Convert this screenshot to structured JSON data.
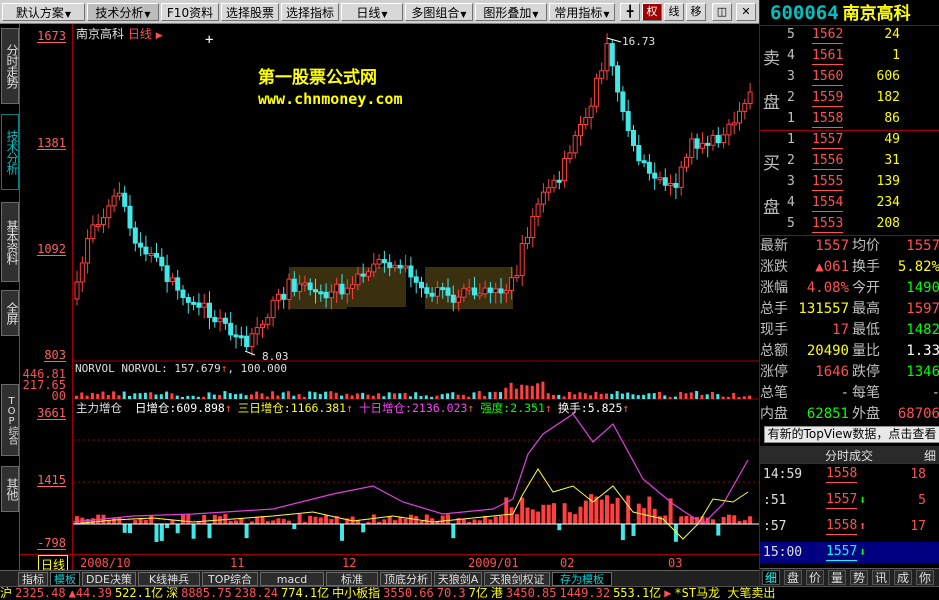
{
  "menubar": {
    "items": [
      {
        "label": "默认方案",
        "dd": true
      },
      {
        "label": "技术分析",
        "dd": true
      },
      {
        "label": "F10资料"
      },
      {
        "label": "选择股票"
      },
      {
        "label": "选择指标"
      },
      {
        "label": "日线",
        "dd": true
      },
      {
        "label": "多图组合",
        "dd": true
      },
      {
        "label": "图形叠加",
        "dd": true
      },
      {
        "label": "常用指标",
        "dd": true
      }
    ],
    "tools": [
      {
        "name": "crosshair-icon",
        "glyph": "╋"
      },
      {
        "name": "quan-button",
        "glyph": "权"
      },
      {
        "name": "line-button",
        "glyph": "线"
      },
      {
        "name": "move-button",
        "glyph": "移"
      },
      {
        "name": "toggle-panel-icon",
        "glyph": "◫"
      },
      {
        "name": "close-icon",
        "glyph": "✕"
      }
    ]
  },
  "left_tabs": [
    {
      "label": "分时走势",
      "active": false
    },
    {
      "label": "技术分析",
      "active": true
    },
    {
      "label": "基本资料",
      "active": false
    },
    {
      "label": "全屏",
      "active": false
    },
    {
      "label": "TOP综合",
      "active": false
    },
    {
      "label": "其他",
      "active": false
    }
  ],
  "y_axis": {
    "main": [
      "1673",
      "1381",
      "1092",
      "803"
    ],
    "vol": [
      "446.81",
      "217.65",
      "00"
    ],
    "ind": [
      "3661",
      "1415",
      "-798"
    ]
  },
  "x_axis": {
    "period": "日线",
    "labels": [
      "2008/10",
      "11",
      "12",
      "2009/01",
      "02",
      "03"
    ],
    "max_label": "16.73",
    "min_label": "8.03"
  },
  "chart_header": {
    "stock": "南京高科",
    "period": "日线",
    "indicator_mark": "▶"
  },
  "watermark": {
    "line1": "第一股票公式网",
    "line2": "www.chnmoney.com"
  },
  "vol_header": {
    "name": "NORVOL",
    "text": "NORVOL: 157.679",
    "arrow": "↑",
    "value2": ", 100.000"
  },
  "ind_header": {
    "title": "主力增仓",
    "items": [
      {
        "label": "日增仓:",
        "value": "609.898",
        "arrow": "↑",
        "color": "#ffffff"
      },
      {
        "label": "三日增仓:",
        "value": "1166.381",
        "arrow": "↑",
        "color": "#ffff00"
      },
      {
        "label": "十日增仓:",
        "value": "2136.023",
        "arrow": "↑",
        "color": "#ff40ff"
      },
      {
        "label": "强度:",
        "value": "2.351",
        "arrow": "↑",
        "color": "#00ff00"
      },
      {
        "label": "换手:",
        "value": "5.825",
        "arrow": "↑",
        "color": "#ffffff"
      }
    ]
  },
  "bottom_tabs": [
    {
      "label": "指标"
    },
    {
      "label": "模板",
      "active": true
    },
    {
      "label": "DDE决策"
    },
    {
      "label": "K线神兵"
    },
    {
      "label": "TOP综合"
    },
    {
      "label": "macd"
    },
    {
      "label": "标准"
    },
    {
      "label": "顶底分析"
    },
    {
      "label": "天狼剑A"
    },
    {
      "label": "天狼剑权证"
    },
    {
      "label": "存为模板",
      "active": true
    }
  ],
  "ticker": [
    {
      "t": "沪",
      "c": "#ffff00"
    },
    {
      "t": "2325.48",
      "c": "#ff5050"
    },
    {
      "t": "▲44.39",
      "c": "#ff5050"
    },
    {
      "t": "522.1亿",
      "c": "#ffff00"
    },
    {
      "t": "深",
      "c": "#ffff00"
    },
    {
      "t": "8885.75",
      "c": "#ff5050"
    },
    {
      "t": "238.24",
      "c": "#ff5050"
    },
    {
      "t": "774.1亿",
      "c": "#ffff00"
    },
    {
      "t": "中小板指",
      "c": "#ffff00"
    },
    {
      "t": "3550.66",
      "c": "#ff5050"
    },
    {
      "t": "70.3",
      "c": "#ff5050"
    },
    {
      "t": "7亿",
      "c": "#ffff00"
    },
    {
      "t": "港",
      "c": "#ffff00"
    },
    {
      "t": "3450.85",
      "c": "#ff5050"
    },
    {
      "t": "1449.32",
      "c": "#ff5050"
    },
    {
      "t": "553.1亿",
      "c": "#ffff00"
    },
    {
      "t": "▶",
      "c": "#ff5050"
    },
    {
      "t": "*ST马龙 大笔卖出",
      "c": "#ffff00"
    }
  ],
  "right": {
    "code": "600064",
    "name": "南京高科",
    "sell_label": [
      "卖",
      "盘"
    ],
    "buy_label": [
      "买",
      "盘"
    ],
    "sell": [
      {
        "lv": "5",
        "price": "1562",
        "vol": "24"
      },
      {
        "lv": "4",
        "price": "1561",
        "vol": "1"
      },
      {
        "lv": "3",
        "price": "1560",
        "vol": "606"
      },
      {
        "lv": "2",
        "price": "1559",
        "vol": "182"
      },
      {
        "lv": "1",
        "price": "1558",
        "vol": "86"
      }
    ],
    "buy": [
      {
        "lv": "1",
        "price": "1557",
        "vol": "49"
      },
      {
        "lv": "2",
        "price": "1556",
        "vol": "31"
      },
      {
        "lv": "3",
        "price": "1555",
        "vol": "139"
      },
      {
        "lv": "4",
        "price": "1554",
        "vol": "234"
      },
      {
        "lv": "5",
        "price": "1553",
        "vol": "208"
      }
    ],
    "quotes": [
      {
        "l1": "最新",
        "v1": "1557",
        "c1": "#ff5050",
        "l2": "均价",
        "v2": "1557",
        "c2": "#ff5050"
      },
      {
        "l1": "涨跌",
        "v1": "▲061",
        "c1": "#ff5050",
        "l2": "换手",
        "v2": "5.82%",
        "c2": "#ffff00"
      },
      {
        "l1": "涨幅",
        "v1": "4.08%",
        "c1": "#ff5050",
        "l2": "今开",
        "v2": "1490",
        "c2": "#00ff00"
      },
      {
        "l1": "总手",
        "v1": "131557",
        "c1": "#ffff00",
        "l2": "最高",
        "v2": "1597",
        "c2": "#ff5050"
      },
      {
        "l1": "现手",
        "v1": "17",
        "c1": "#ff5050",
        "l2": "最低",
        "v2": "1482",
        "c2": "#00ff00"
      },
      {
        "l1": "总额",
        "v1": "20490",
        "c1": "#ffff00",
        "l2": "量比",
        "v2": "1.33",
        "c2": "#ffffff"
      },
      {
        "l1": "涨停",
        "v1": "1646",
        "c1": "#ff5050",
        "l2": "跌停",
        "v2": "1346",
        "c2": "#00ff00"
      },
      {
        "l1": "总笔",
        "v1": "-",
        "c1": "#c0c0c0",
        "l2": "每笔",
        "v2": "-",
        "c2": "#c0c0c0"
      },
      {
        "l1": "内盘",
        "v1": "62851",
        "c1": "#00ff00",
        "l2": "外盘",
        "v2": "68706",
        "c2": "#ff5050"
      }
    ],
    "topview": "有新的TopView数据，点击查看",
    "fs_title": "分时成交",
    "fs_detail": "细",
    "fs": [
      {
        "t": "14:59",
        "p": "1558",
        "a": "",
        "ac": "#ff5050",
        "v": "18"
      },
      {
        "t": ":51",
        "p": "1557",
        "a": "⬇",
        "ac": "#00ff00",
        "v": "5"
      },
      {
        "t": ":57",
        "p": "1558",
        "a": "⬆",
        "ac": "#ff5050",
        "v": "17"
      },
      {
        "t": "15:00",
        "p": "1557",
        "a": "⬇",
        "ac": "#00ff00",
        "v": "",
        "sel": true
      }
    ],
    "tabs": [
      "细",
      "盘",
      "价",
      "量",
      "势",
      "讯",
      "成",
      "你"
    ]
  }
}
